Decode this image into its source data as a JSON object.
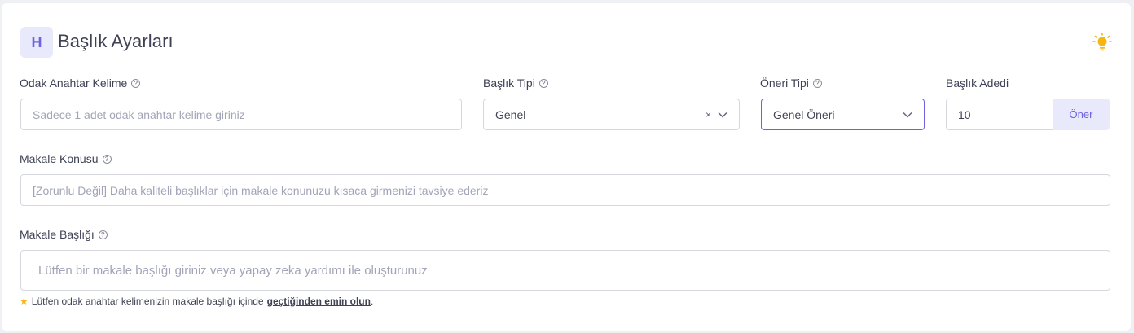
{
  "header": {
    "badge": "H",
    "title": "Başlık Ayarları",
    "tip_icon": "lightbulb-icon"
  },
  "fields": {
    "focus_keyword": {
      "label": "Odak Anahtar Kelime",
      "placeholder": "Sadece 1 adet odak anahtar kelime giriniz"
    },
    "title_type": {
      "label": "Başlık Tipi",
      "value": "Genel",
      "clear": "×"
    },
    "suggestion_type": {
      "label": "Öneri Tipi",
      "value": "Genel Öneri"
    },
    "title_count": {
      "label": "Başlık Adedi",
      "value": "10",
      "button": "Öner"
    },
    "article_topic": {
      "label": "Makale Konusu",
      "placeholder": "[Zorunlu Değil] Daha kaliteli başlıklar için makale konunuzu kısaca girmenizi tavsiye ederiz"
    },
    "article_title": {
      "label": "Makale Başlığı",
      "placeholder": "Lütfen bir makale başlığı giriniz veya yapay zeka yardımı ile oluşturunuz"
    }
  },
  "note": {
    "star": "★",
    "text": "Lütfen odak anahtar kelimenizin makale başlığı içinde",
    "link": "geçtiğinden emin olun",
    "end": "."
  },
  "colors": {
    "accent": "#6c63e0",
    "accent_light": "#e8e9fb",
    "star": "#f6b60f",
    "bulb": "#f6b60f"
  }
}
